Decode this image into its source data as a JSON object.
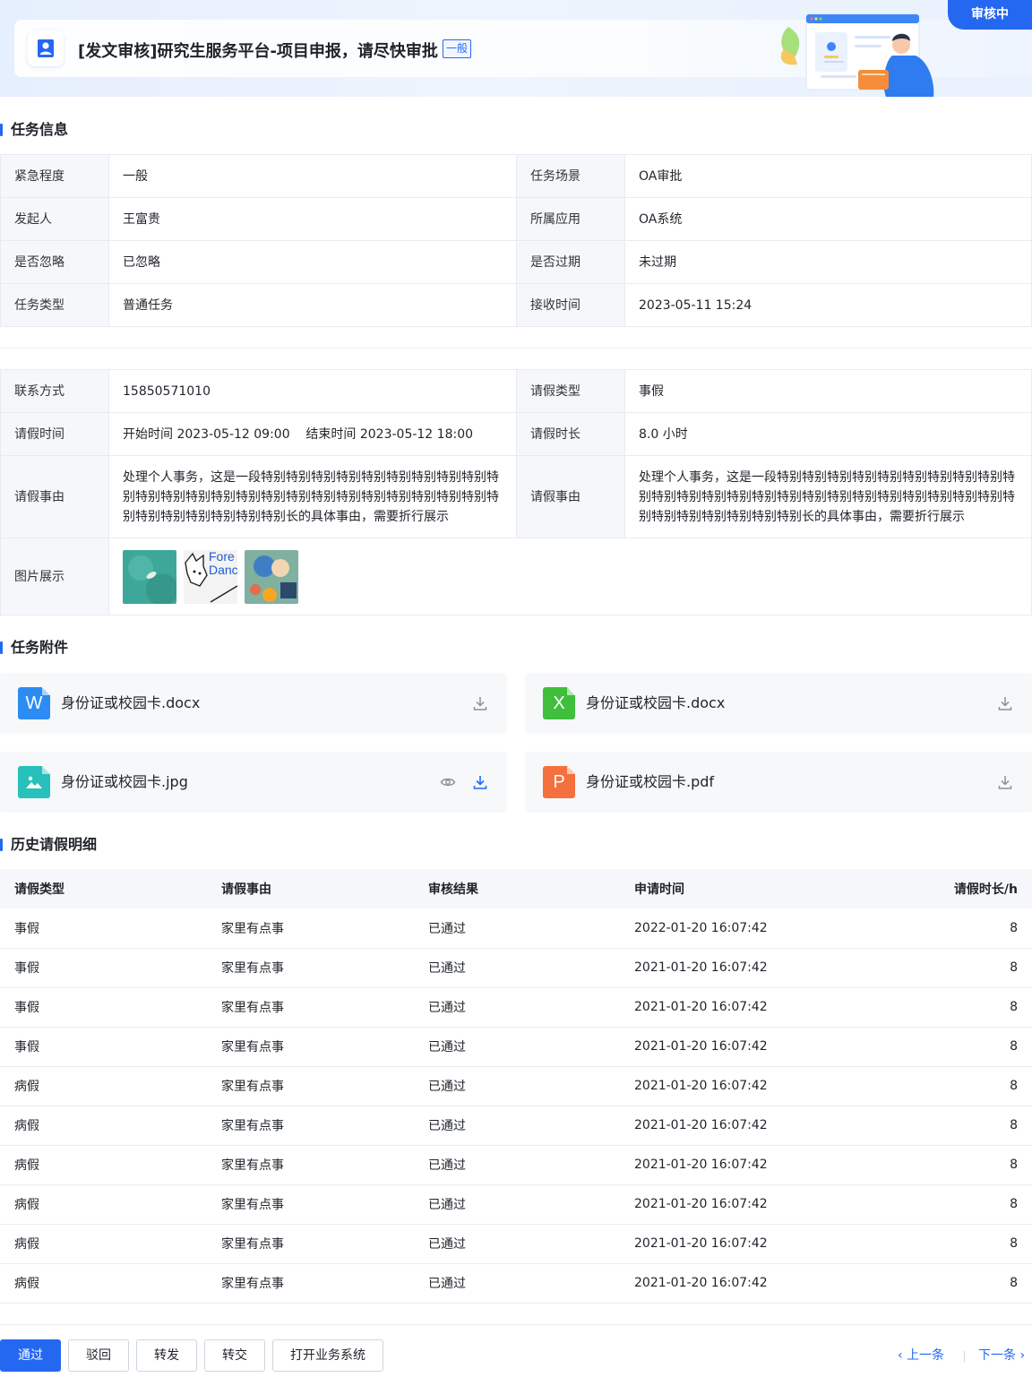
{
  "header": {
    "title": "[发文审核]研究生服务平台-项目申报，请尽快审批",
    "urgency_tag": "一般",
    "status": "审核中"
  },
  "task_info": {
    "section_title": "任务信息",
    "rows": [
      {
        "label1": "紧急程度",
        "value1": "一般",
        "label2": "任务场景",
        "value2": "OA审批"
      },
      {
        "label1": "发起人",
        "value1": "王富贵",
        "label2": "所属应用",
        "value2": "OA系统"
      },
      {
        "label1": "是否忽略",
        "value1": "已忽略",
        "label2": "是否过期",
        "value2": "未过期"
      },
      {
        "label1": "任务类型",
        "value1": "普通任务",
        "label2": "接收时间",
        "value2": "2023-05-11 15:24"
      }
    ]
  },
  "leave_info": {
    "contact_label": "联系方式",
    "contact_value": "15850571010",
    "type_label": "请假类型",
    "type_value": "事假",
    "time_label": "请假时间",
    "time_value": "开始时间 2023-05-12 09:00    结束时间 2023-05-12 18:00",
    "duration_label": "请假时长",
    "duration_value": "8.0 小时",
    "reason_label": "请假事由",
    "reason_value": "处理个人事务，这是一段特别特别特别特别特别特别特别特别特别特别特别特别特别特别特别特别特别特别特别特别特别特别特别特别特别特别特别特别特别特别特别长的具体事由，需要折行展示",
    "reason_label2": "请假事由",
    "reason_value2": "处理个人事务，这是一段特别特别特别特别特别特别特别特别特别特别特别特别特别特别特别特别特别特别特别特别特别特别特别特别特别特别特别特别特别特别特别长的具体事由，需要折行展示",
    "images_label": "图片展示",
    "thumb2_text": "Fore Danc"
  },
  "attachments": {
    "section_title": "任务附件",
    "items": [
      {
        "icon": "W",
        "name": "身份证或校园卡.docx",
        "color": "#2c8cf4"
      },
      {
        "icon": "X",
        "name": "身份证或校园卡.docx",
        "color": "#3fbf3c"
      },
      {
        "icon": "image",
        "name": "身份证或校园卡.jpg",
        "color": "#27c0ba"
      },
      {
        "icon": "P",
        "name": "身份证或校园卡.pdf",
        "color": "#f5703f"
      }
    ]
  },
  "history": {
    "section_title": "历史请假明细",
    "columns": [
      "请假类型",
      "请假事由",
      "审核结果",
      "申请时间",
      "请假时长/h"
    ],
    "rows": [
      [
        "事假",
        "家里有点事",
        "已通过",
        "2022-01-20 16:07:42",
        "8"
      ],
      [
        "事假",
        "家里有点事",
        "已通过",
        "2021-01-20 16:07:42",
        "8"
      ],
      [
        "事假",
        "家里有点事",
        "已通过",
        "2021-01-20 16:07:42",
        "8"
      ],
      [
        "事假",
        "家里有点事",
        "已通过",
        "2021-01-20 16:07:42",
        "8"
      ],
      [
        "病假",
        "家里有点事",
        "已通过",
        "2021-01-20 16:07:42",
        "8"
      ],
      [
        "病假",
        "家里有点事",
        "已通过",
        "2021-01-20 16:07:42",
        "8"
      ],
      [
        "病假",
        "家里有点事",
        "已通过",
        "2021-01-20 16:07:42",
        "8"
      ],
      [
        "病假",
        "家里有点事",
        "已通过",
        "2021-01-20 16:07:42",
        "8"
      ],
      [
        "病假",
        "家里有点事",
        "已通过",
        "2021-01-20 16:07:42",
        "8"
      ],
      [
        "病假",
        "家里有点事",
        "已通过",
        "2021-01-20 16:07:42",
        "8"
      ]
    ]
  },
  "footer": {
    "approve": "通过",
    "reject": "驳回",
    "forward": "转发",
    "transfer": "转交",
    "open_system": "打开业务系统",
    "prev": "上一条",
    "next": "下一条"
  },
  "colors": {
    "primary": "#2468f2",
    "label_bg": "#f5f7fa"
  }
}
